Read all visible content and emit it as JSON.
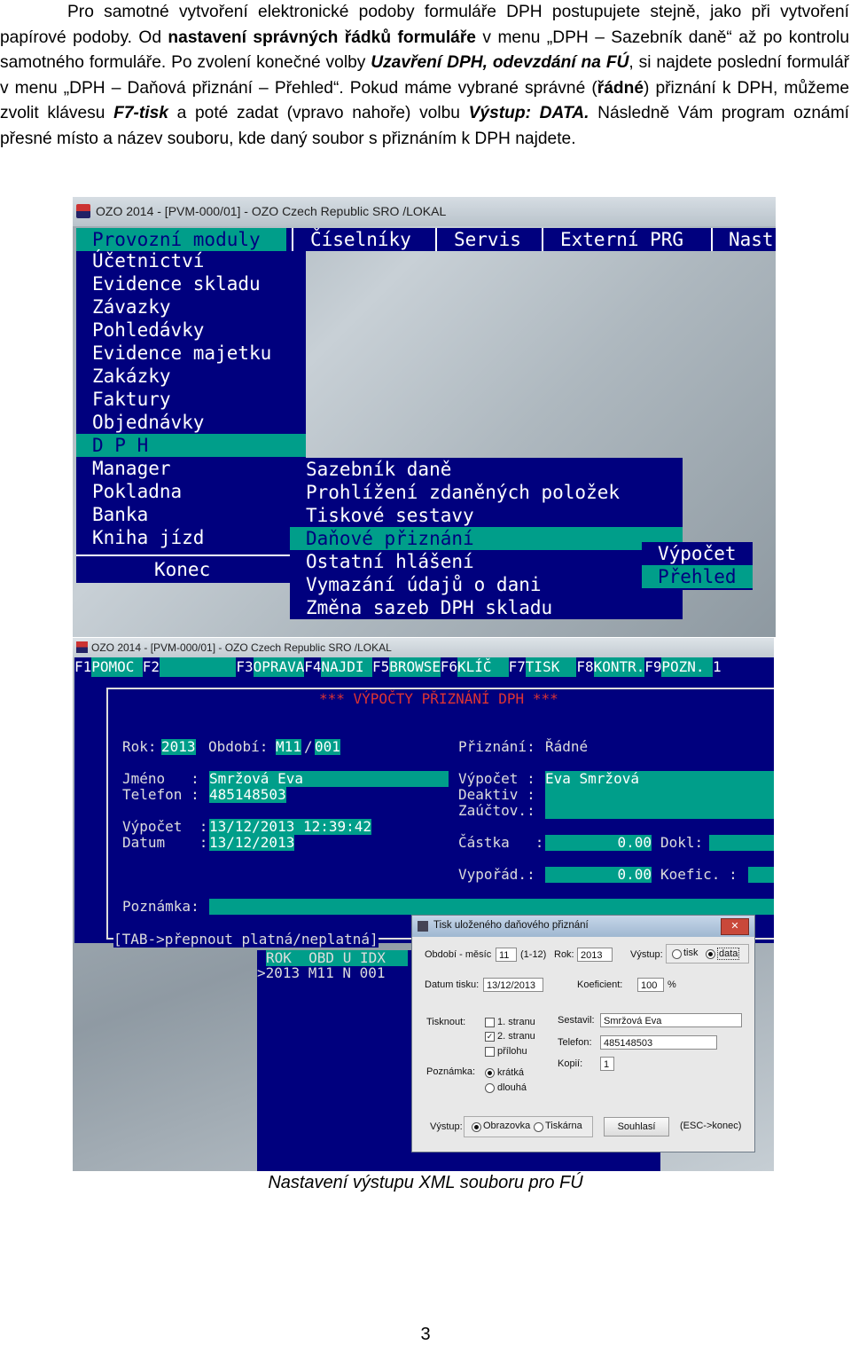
{
  "document": {
    "paragraph": [
      {
        "t": "Pro samotné vytvoření elektronické podoby formuláře DPH postupujete stejně, jako při vytvoření papírové podoby. Od ",
        "s": ""
      },
      {
        "t": "nastavení správných řádků formuláře",
        "s": "b"
      },
      {
        "t": " v menu „DPH – Sazebník daně“ až po kontrolu samotného formuláře. Po zvolení konečné volby ",
        "s": ""
      },
      {
        "t": "Uzavření DPH, odevzdání na FÚ",
        "s": "bi"
      },
      {
        "t": ", si najdete poslední formulář v menu „DPH – Daňová přiznání – Přehled“. Pokud máme vybrané správné (",
        "s": ""
      },
      {
        "t": "řádné",
        "s": "b"
      },
      {
        "t": ") přiznání k DPH, můžeme zvolit klávesu ",
        "s": ""
      },
      {
        "t": "F7-tisk",
        "s": "bi"
      },
      {
        "t": " a poté zadat (vpravo nahoře) volbu ",
        "s": ""
      },
      {
        "t": "Výstup: DATA.",
        "s": "bi"
      },
      {
        "t": " Následně Vám program oznámí přesné místo a název souboru, kde daný soubor s přiznáním k DPH najdete.",
        "s": ""
      }
    ],
    "caption": "Nastavení výstupu XML souboru pro FÚ",
    "page_number": "3"
  },
  "shot1": {
    "title": "OZO 2014 - [PVM-000/01] - OZO Czech Republic SRO  /LOKAL",
    "menubar": [
      "Provozní moduly",
      "Číselníky",
      "Servis",
      "Externí PRG",
      "Nast"
    ],
    "menu_modules": [
      "Účetnictví",
      "Evidence skladu",
      "Závazky",
      "Pohledávky",
      "Evidence majetku",
      "Zakázky",
      "Faktury",
      "Objednávky",
      "D P H",
      "Manager",
      "Pokladna",
      "Banka",
      "Kniha jízd"
    ],
    "konec": "Konec",
    "menu_dph": [
      "Sazebník daně",
      "Prohlížení zdaněných položek",
      "Tiskové sestavy",
      "Daňové přiznání",
      "Ostatní hlášení",
      "Vymazání údajů o dani",
      "Změna sazeb DPH skladu"
    ],
    "menu_priznani": [
      "Výpočet",
      "Přehled"
    ]
  },
  "shot2": {
    "title": "OZO 2014 - [PVM-000/01] - OZO Czech Republic SRO  /LOKAL",
    "fkeys": [
      {
        "k": "F1",
        "v": "POMOC"
      },
      {
        "k": "F2",
        "v": ""
      },
      {
        "k": "F3",
        "v": "OPRAVA"
      },
      {
        "k": "F4",
        "v": "NAJDI"
      },
      {
        "k": "F5",
        "v": "BROWSE"
      },
      {
        "k": "F6",
        "v": " KLÍČ "
      },
      {
        "k": "F7",
        "v": " TISK "
      },
      {
        "k": "F8",
        "v": "KONTR."
      },
      {
        "k": "F9",
        "v": "POZN. "
      },
      {
        "k": "1",
        "v": ""
      }
    ],
    "heading": "*** VÝPOČTY PŘIZNÁNÍ DPH ***",
    "rok_label": "Rok:",
    "rok": "2013",
    "obdobi_label": "Období:",
    "obdobi_m": "M11",
    "obdobi_sep": "/",
    "obdobi_n": "001",
    "priznani_label": "Přiznání:",
    "priznani": "Řádné",
    "jmeno_label": "Jméno   :",
    "jmeno": "Smržová Eva",
    "telefon_label": "Telefon :",
    "telefon": "485148503",
    "vypocet_r_label": "Výpočet :",
    "vypocet_r": "Eva Smržová",
    "deaktiv_label": "Deaktiv :",
    "zauctov_label": "Zaúčtov.:",
    "vypocet_label": "Výpočet  :",
    "vypocet": "13/12/2013 12:39:42",
    "datum_label": "Datum    :",
    "datum": "13/12/2013",
    "castka_label": "Částka   :",
    "castka": "0.00",
    "dokl_label": "Dokl:",
    "vyporad_label": "Vypořád.:",
    "vyporad": "0.00",
    "koefic_label": "Koefic. :",
    "poznamka_label": "Poznámka:",
    "tab_hint": "[TAB->přepnout platná/neplatná]",
    "list_header": "ROK  OBD U IDX",
    "list_row": ">2013 M11 N 001",
    "dialog": {
      "title": "Tisk uloženého daňového přiznání",
      "close": "✕",
      "obdobi_label": "Období - měsíc",
      "obdobi": "11",
      "range": "(1-12)",
      "rok_label": "Rok:",
      "rok": "2013",
      "vystup_label": "Výstup:",
      "opt_tisk": "tisk",
      "opt_data": "data",
      "datum_label": "Datum tisku:",
      "datum": "13/12/2013",
      "koef_label": "Koeficient:",
      "koef": "100",
      "pct": "%",
      "tisknout_label": "Tisknout:",
      "c1": "1. stranu",
      "c2": "2. stranu",
      "c3": "přílohu",
      "sestavil_label": "Sestavil:",
      "sestavil": "Smržová Eva",
      "telefon_label": "Telefon:",
      "telefon": "485148503",
      "kopii_label": "Kopií:",
      "kopii": "1",
      "poznamka_label": "Poznámka:",
      "p1": "krátká",
      "p2": "dlouhá",
      "vystup2_label": "Výstup:",
      "o1": "Obrazovka",
      "o2": "Tiskárna",
      "btn_ok": "Souhlasí",
      "btn_esc": "(ESC->konec)"
    }
  }
}
